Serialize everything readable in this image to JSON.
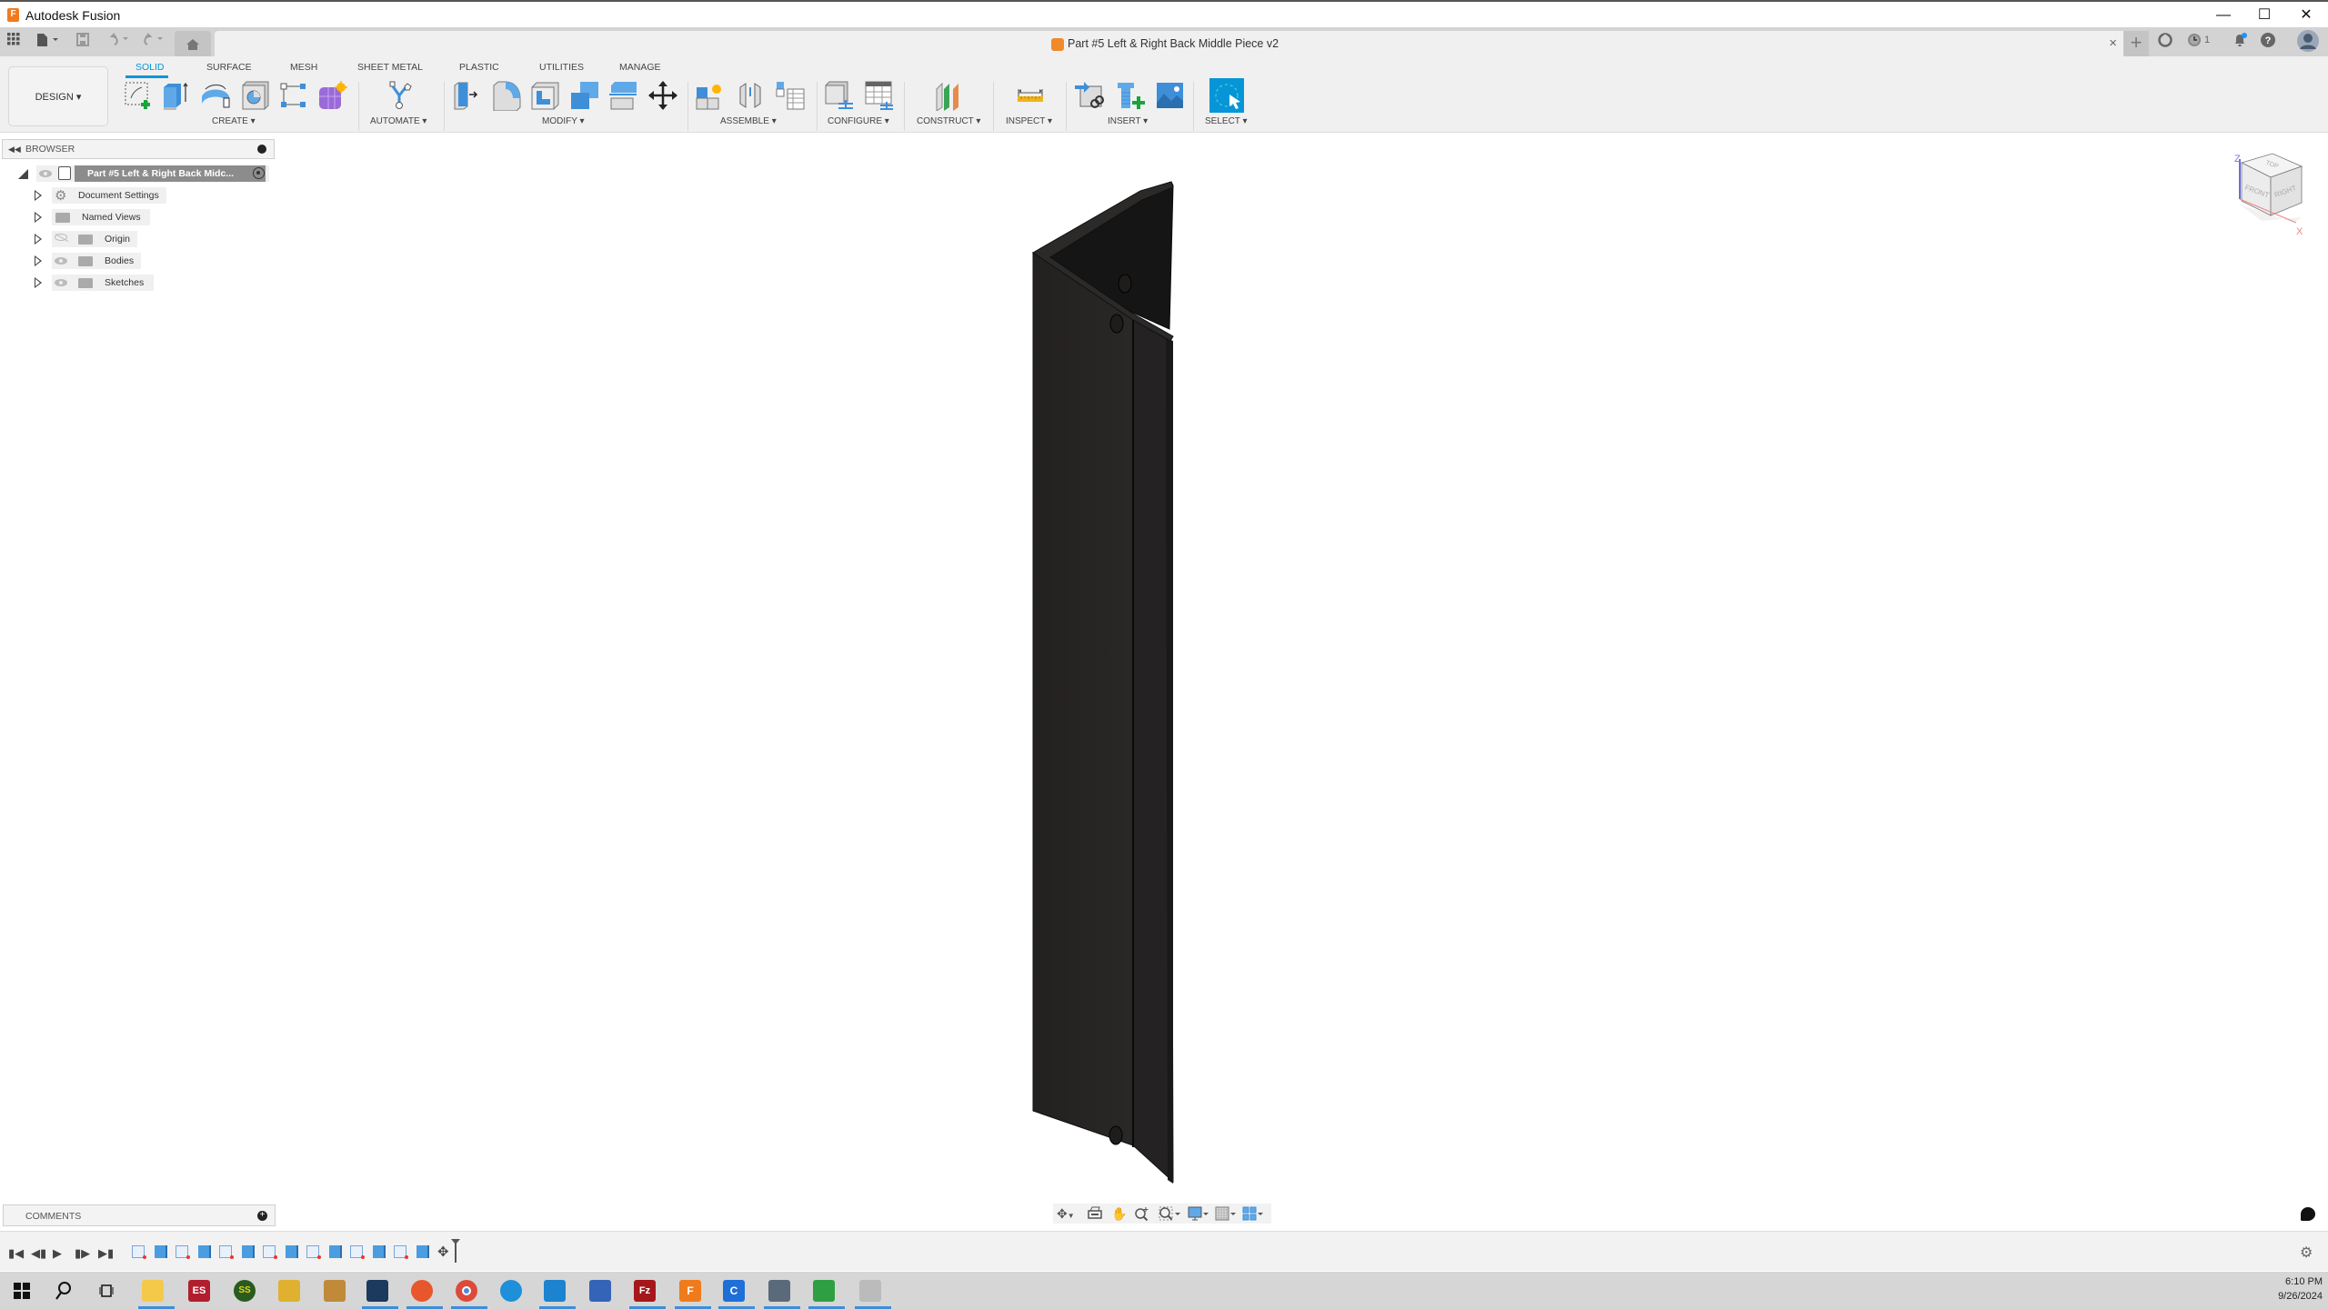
{
  "window": {
    "app_title": "Autodesk Fusion",
    "controls": [
      "minimize",
      "maximize",
      "close"
    ]
  },
  "quick_access": {
    "items": [
      "data-panel-icon",
      "file-menu-icon",
      "save-icon",
      "undo-icon",
      "redo-icon",
      "home-icon"
    ]
  },
  "document_tab": {
    "title": "Part #5 Left & Right Back Middle Piece v2",
    "close_label": "×"
  },
  "top_right": {
    "new_tab": "+",
    "job_status_count": "1"
  },
  "ribbon": {
    "workspace": "DESIGN ▾",
    "tabs": [
      {
        "label": "SOLID",
        "active": true
      },
      {
        "label": "SURFACE",
        "active": false
      },
      {
        "label": "MESH",
        "active": false
      },
      {
        "label": "SHEET METAL",
        "active": false
      },
      {
        "label": "PLASTIC",
        "active": false
      },
      {
        "label": "UTILITIES",
        "active": false
      },
      {
        "label": "MANAGE",
        "active": false
      }
    ],
    "groups": [
      {
        "label": "CREATE ▾",
        "tools": [
          "create-sketch",
          "extrude",
          "revolve",
          "hole",
          "pattern",
          "form"
        ]
      },
      {
        "label": "AUTOMATE ▾",
        "tools": [
          "automate"
        ]
      },
      {
        "label": "MODIFY ▾",
        "tools": [
          "press-pull",
          "fillet",
          "shell",
          "combine",
          "offset-face",
          "move-copy"
        ]
      },
      {
        "label": "ASSEMBLE ▾",
        "tools": [
          "new-component",
          "joint",
          "bill-of-materials"
        ]
      },
      {
        "label": "CONFIGURE ▾",
        "tools": [
          "change-parameters",
          "configuration-table"
        ]
      },
      {
        "label": "CONSTRUCT ▾",
        "tools": [
          "offset-plane"
        ]
      },
      {
        "label": "INSPECT ▾",
        "tools": [
          "measure"
        ]
      },
      {
        "label": "INSERT ▾",
        "tools": [
          "insert-derive",
          "insert-mcmaster",
          "insert-canvas"
        ]
      },
      {
        "label": "SELECT ▾",
        "tools": [
          "select"
        ]
      }
    ]
  },
  "browser": {
    "title": "BROWSER",
    "root": "Part #5 Left & Right Back Midc...",
    "items": [
      {
        "label": "Document Settings",
        "icon": "gear-icon",
        "visible": null
      },
      {
        "label": "Named Views",
        "icon": "folder-icon",
        "visible": null
      },
      {
        "label": "Origin",
        "icon": "folder-icon",
        "visible": false
      },
      {
        "label": "Bodies",
        "icon": "folder-icon",
        "visible": true
      },
      {
        "label": "Sketches",
        "icon": "folder-icon",
        "visible": true
      }
    ]
  },
  "comments": {
    "title": "COMMENTS"
  },
  "viewcube": {
    "faces": [
      "TOP",
      "FRONT",
      "RIGHT"
    ],
    "axes": [
      "Z",
      "X"
    ]
  },
  "timeline": {
    "controls": [
      "go-to-start",
      "step-back",
      "play",
      "step-forward",
      "go-to-end"
    ],
    "features": [
      "sketch",
      "extrude",
      "sketch",
      "extrude",
      "sketch",
      "extrude",
      "sketch",
      "extrude",
      "sketch",
      "extrude",
      "sketch",
      "extrude",
      "sketch",
      "extrude",
      "move"
    ]
  },
  "navbar": {
    "tools": [
      "orbit",
      "look-at",
      "pan",
      "zoom",
      "fit",
      "display-settings",
      "grid-snaps",
      "viewports"
    ]
  },
  "taskbar": {
    "apps": [
      "start",
      "search",
      "task-view",
      "file-explorer",
      "es-app",
      "ss-app",
      "pen-app",
      "media-app",
      "virtualbox",
      "firefox",
      "chrome",
      "edge",
      "vscode",
      "network-app",
      "filezilla",
      "fusion",
      "c-app",
      "calculator",
      "sheets-app",
      "misc-app"
    ],
    "time": "6:10 PM",
    "date": "9/26/2024"
  }
}
